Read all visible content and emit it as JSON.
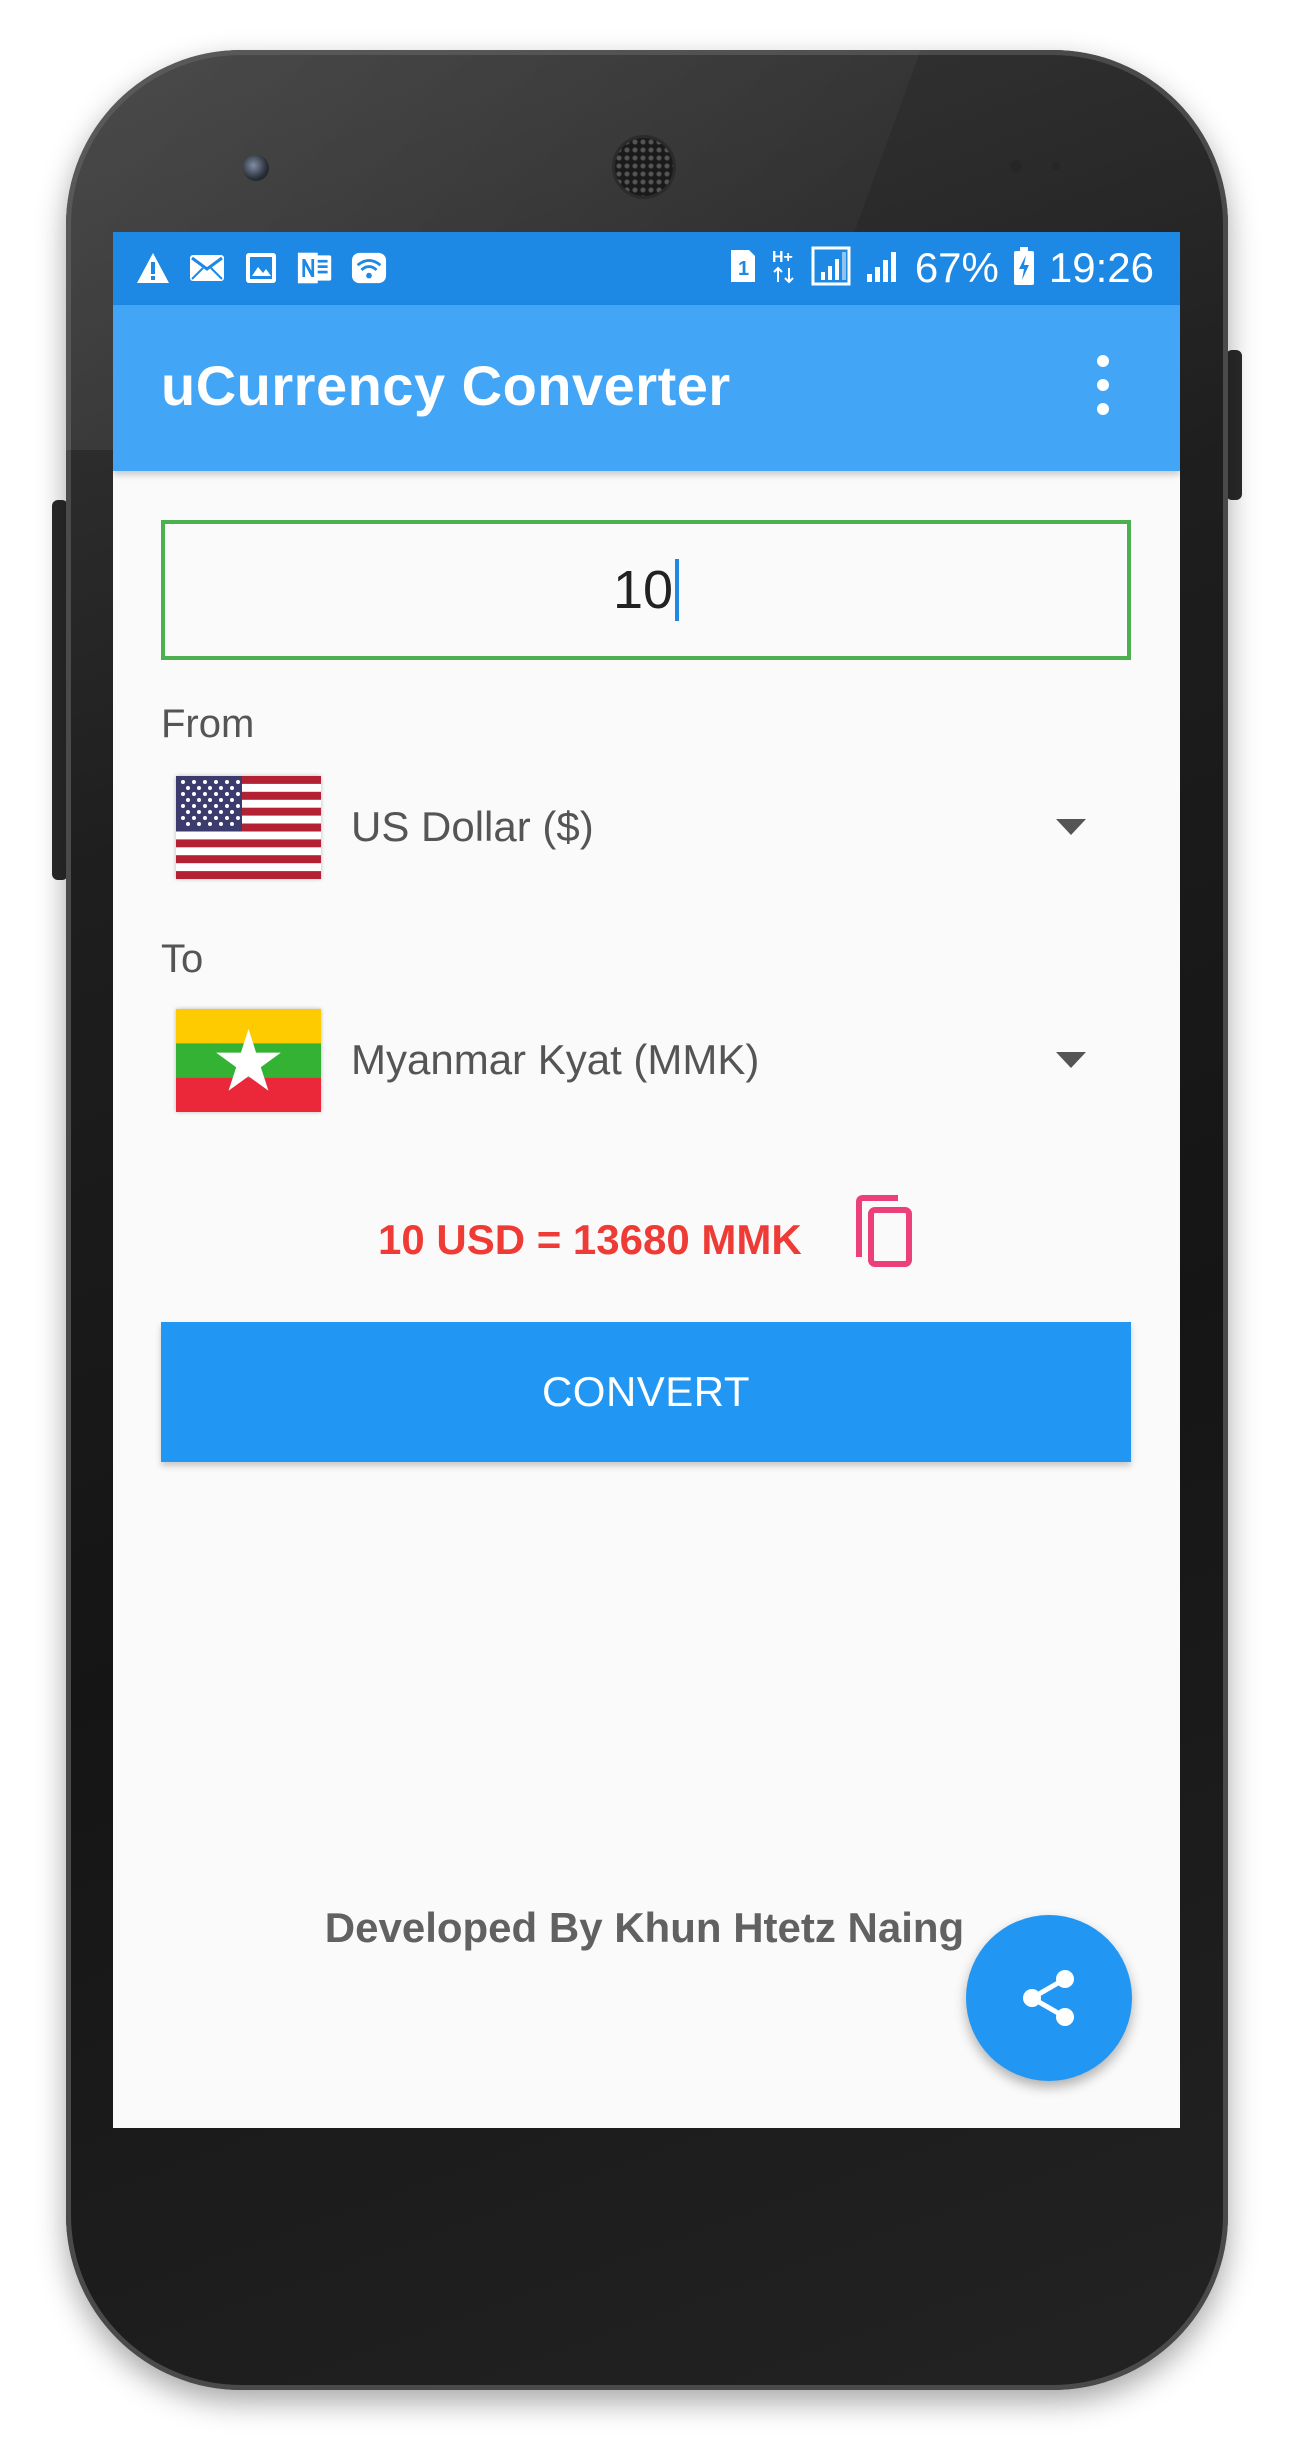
{
  "status_bar": {
    "battery_percent": "67%",
    "time": "19:26",
    "left_icons": [
      "warning-icon",
      "mail-icon",
      "image-icon",
      "onenote-icon",
      "wifi-icon"
    ],
    "right_icons": [
      "sim-icon",
      "hplus-icon",
      "signal-icon",
      "signal-icon",
      "battery-charging-icon"
    ]
  },
  "app_bar": {
    "title": "uCurrency Converter",
    "menu_icon": "more-vert-icon"
  },
  "amount": {
    "value": "10"
  },
  "from": {
    "label": "From",
    "currency": "US Dollar ($)",
    "flag": "us-flag-icon"
  },
  "to": {
    "label": "To",
    "currency": "Myanmar Kyat (MMK)",
    "flag": "myanmar-flag-icon"
  },
  "result": {
    "text": "10 USD = 13680 MMK",
    "copy_icon": "copy-icon"
  },
  "convert_button": {
    "label": "CONVERT"
  },
  "footer": {
    "text": "Developed By Khun Htetz Naing"
  },
  "fab": {
    "icon": "share-icon"
  },
  "colors": {
    "status_bar": "#1e88e5",
    "app_bar": "#42a5f5",
    "accent": "#2196f3",
    "result_text": "#ef3b36",
    "copy_icon": "#ec407a",
    "input_border": "#4caf50"
  }
}
